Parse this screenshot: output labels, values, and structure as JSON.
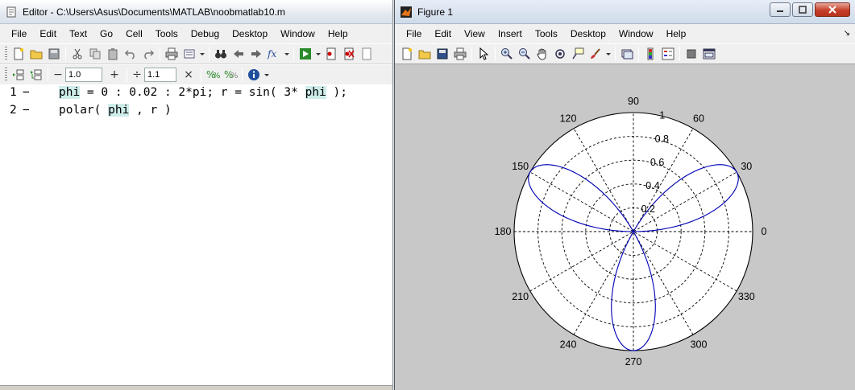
{
  "editor": {
    "title": "Editor - C:\\Users\\Asus\\Documents\\MATLAB\\noobmatlab10.m",
    "menu": [
      "File",
      "Edit",
      "Text",
      "Go",
      "Cell",
      "Tools",
      "Debug",
      "Desktop",
      "Window",
      "Help"
    ],
    "cell_toolbar": {
      "decrement": "−",
      "value_left": "1.0",
      "increment": "+",
      "divide": "÷",
      "value_right": "1.1",
      "multiply": "×"
    },
    "lines": [
      {
        "num": "1",
        "dash": "−",
        "segments": [
          {
            "text": "phi",
            "hl": true
          },
          {
            "text": " = 0 : 0.02 : 2*pi; r = sin( 3* ",
            "hl": false
          },
          {
            "text": "phi",
            "hl": true
          },
          {
            "text": " );",
            "hl": false
          }
        ]
      },
      {
        "num": "2",
        "dash": "−",
        "segments": [
          {
            "text": "polar( ",
            "hl": false
          },
          {
            "text": "phi",
            "hl": true
          },
          {
            "text": " , r )",
            "hl": false
          }
        ]
      }
    ]
  },
  "figure": {
    "title": "Figure 1",
    "menu": [
      "File",
      "Edit",
      "View",
      "Insert",
      "Tools",
      "Desktop",
      "Window",
      "Help"
    ],
    "menu_arrow": "↘"
  },
  "chart_data": {
    "type": "polar",
    "equation_r": "sin(3*phi)",
    "phi_range": [
      0,
      6.2832
    ],
    "phi_step": 0.02,
    "r_max": 1,
    "angle_ticks": [
      0,
      30,
      60,
      90,
      120,
      150,
      180,
      210,
      240,
      270,
      300,
      330
    ],
    "angle_labels": [
      "0",
      "30",
      "60",
      "90",
      "120",
      "150",
      "180",
      "210",
      "240",
      "270",
      "300",
      "330"
    ],
    "radial_ticks": [
      0.2,
      0.4,
      0.6,
      0.8,
      1
    ],
    "radial_labels": [
      "0.2",
      "0.4",
      "0.6",
      "0.8",
      "1"
    ],
    "line_color": "#0000b4",
    "grid": "dashed"
  }
}
